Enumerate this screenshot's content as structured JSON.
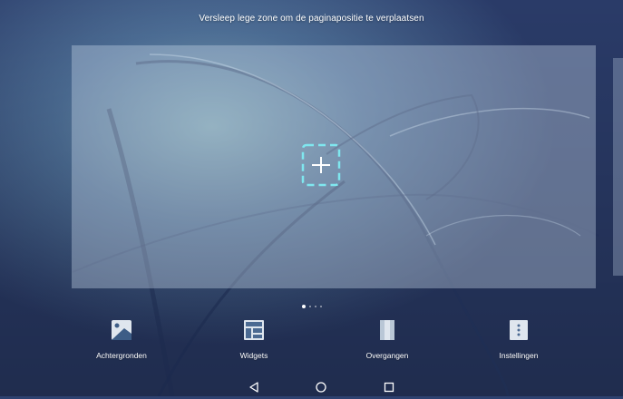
{
  "hint": "Versleep lege zone om de paginapositie te verplaatsen",
  "colors": {
    "wallpaper_top": "#2b3f6e",
    "wallpaper_bottom": "#27355e",
    "panel_overlay": "#c8d7eb",
    "add_button_accent": "#7fe7ef",
    "text": "#ffffff"
  },
  "page_indicator": {
    "total": 4,
    "current": 1
  },
  "add_page_button": {
    "icon": "plus-icon"
  },
  "bottom_menu": [
    {
      "label": "Achtergronden",
      "icon": "wallpaper-icon"
    },
    {
      "label": "Widgets",
      "icon": "widgets-icon"
    },
    {
      "label": "Overgangen",
      "icon": "transitions-icon"
    },
    {
      "label": "Instellingen",
      "icon": "settings-icon"
    }
  ],
  "nav_bar": [
    {
      "icon": "back-triangle-icon"
    },
    {
      "icon": "home-circle-icon"
    },
    {
      "icon": "recents-square-icon"
    }
  ]
}
